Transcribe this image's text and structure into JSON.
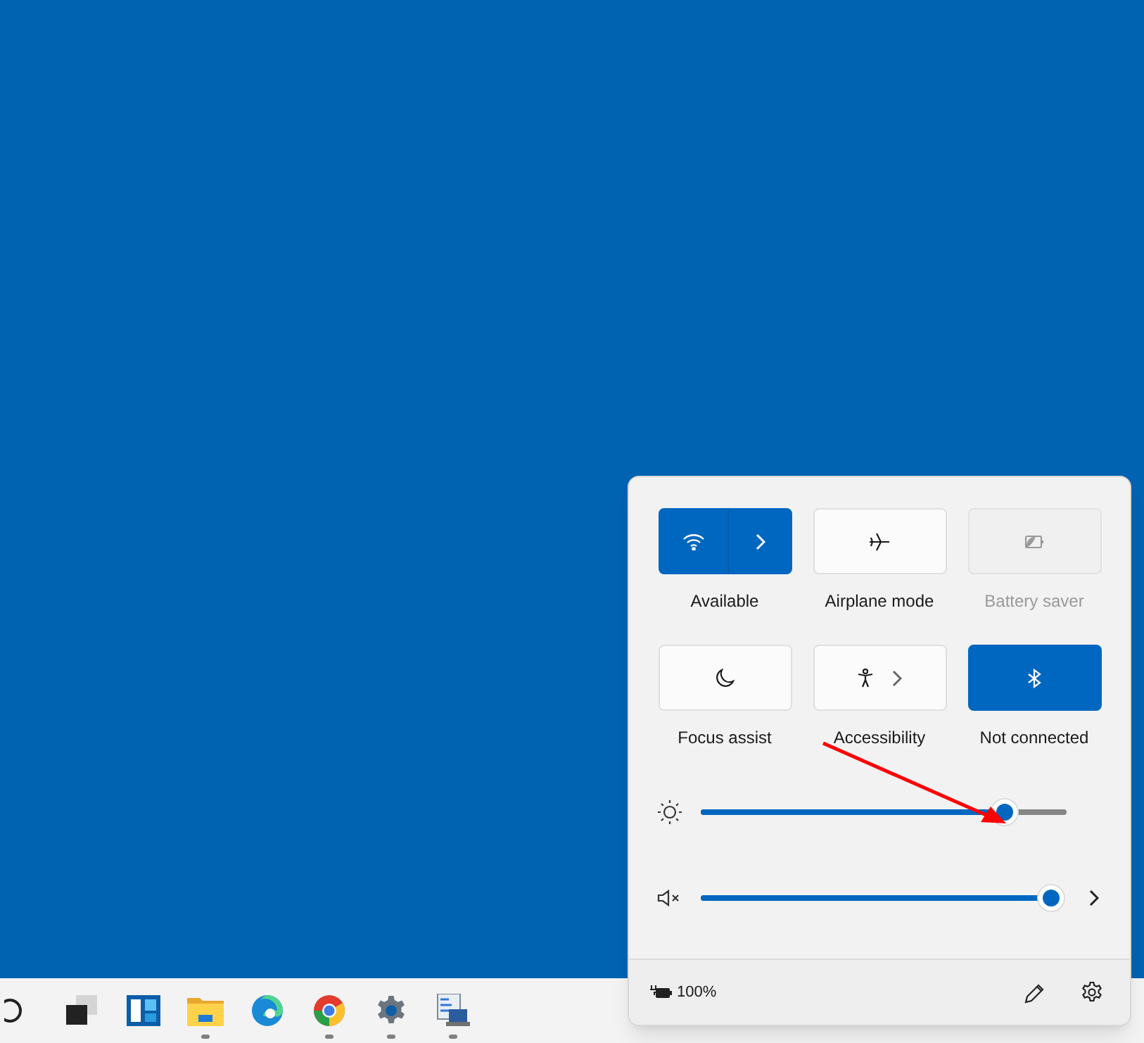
{
  "quick_settings": {
    "tiles": [
      {
        "kind": "split",
        "label": "Available",
        "on": true,
        "disabled": false
      },
      {
        "kind": "plain",
        "label": "Airplane mode",
        "on": false,
        "disabled": false
      },
      {
        "kind": "plain",
        "label": "Battery saver",
        "on": false,
        "disabled": true
      },
      {
        "kind": "plain",
        "label": "Focus assist",
        "on": false,
        "disabled": false
      },
      {
        "kind": "expand",
        "label": "Accessibility",
        "on": false,
        "disabled": false
      },
      {
        "kind": "plain",
        "label": "Not connected",
        "on": true,
        "disabled": false
      }
    ],
    "sliders": [
      {
        "kind": "brightness",
        "level": 0.83,
        "expand": false
      },
      {
        "kind": "volume",
        "muted": true,
        "level": 0.97,
        "expand": true
      }
    ],
    "footer": {
      "battery": "100%"
    }
  },
  "taskbar": {
    "items": [
      {
        "kind": "search",
        "running": false
      },
      {
        "kind": "taskview",
        "running": false
      },
      {
        "kind": "widgets",
        "running": false
      },
      {
        "kind": "explorer",
        "running": true
      },
      {
        "kind": "edge",
        "running": false
      },
      {
        "kind": "chrome",
        "running": true
      },
      {
        "kind": "settings",
        "running": true
      },
      {
        "kind": "remote",
        "running": true
      }
    ]
  }
}
